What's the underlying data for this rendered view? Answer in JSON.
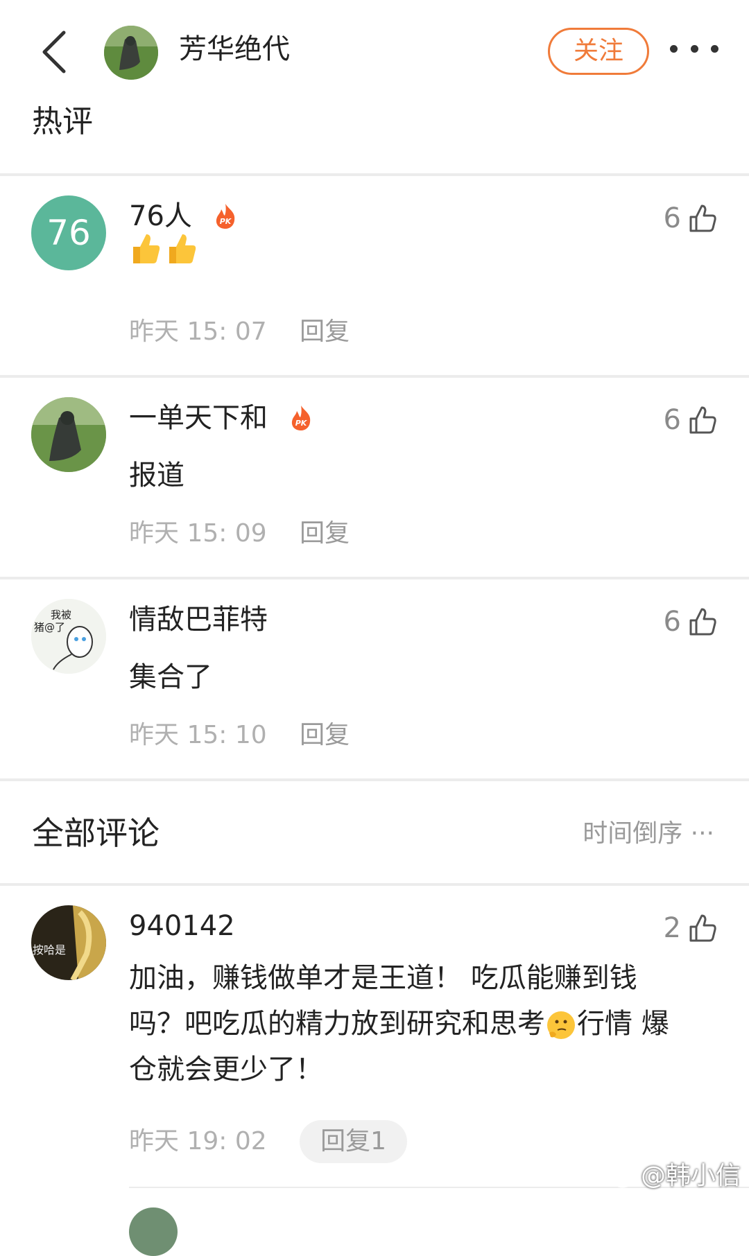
{
  "header": {
    "title": "芳华绝代",
    "follow_label": "关注"
  },
  "hot_section": {
    "title": "热评"
  },
  "hot_comments": [
    {
      "avatar_text": "76",
      "name": "76人",
      "badge": "PK",
      "likes": "6",
      "time": "昨天 15: 07",
      "reply": "回复"
    },
    {
      "name": "一单天下和",
      "badge": "PK",
      "text": "报道",
      "likes": "6",
      "time": "昨天 15: 09",
      "reply": "回复"
    },
    {
      "avatar_text_1": "我被",
      "avatar_text_2": "猪@了",
      "name": "情敌巴菲特",
      "text": "集合了",
      "likes": "6",
      "time": "昨天 15: 10",
      "reply": "回复"
    }
  ],
  "all_section": {
    "title": "全部评论",
    "sort_label": "时间倒序 ···"
  },
  "all_comments": [
    {
      "avatar_text": "按哈是",
      "name": "940142",
      "likes": "2",
      "text_line1": "加油，赚钱做单才是王道！ 吃瓜能赚到钱",
      "text_line2a": "吗？吧吃瓜的精力放到研究和思考",
      "text_line2b": "行情 爆",
      "text_line3": "仓就会更少了！",
      "time": "昨天 19: 02",
      "reply": "回复1"
    }
  ],
  "watermark": "@韩小信",
  "colors": {
    "accent": "#f07b3a",
    "avatar_76": "#5bb79a",
    "meta": "#b0b0b0"
  }
}
